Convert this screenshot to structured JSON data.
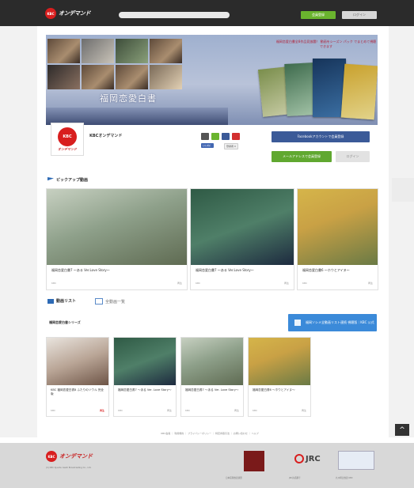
{
  "header": {
    "logo_mark": "KBC",
    "logo_text": "オンデマンド",
    "search_placeholder": "",
    "login_label": "会員登録",
    "signup_label": "ログイン"
  },
  "banner": {
    "title": "福岡恋愛白書",
    "caption": "福岡恋愛白書全8作品見放題！ 動画をシーズン パック でまとめて視聴できます"
  },
  "channel": {
    "name": "KBCオンデマンド",
    "facebook_button": "Facebookアカウントで会員登録",
    "register_button": "メールアドレスで会員登録",
    "guest_button": "ログイン",
    "like_label": "いいね！",
    "subscribe_label": "登録者 0"
  },
  "pickup": {
    "title": "ピックアップ動画",
    "cards": [
      {
        "title": "福岡恋愛白書7 ～ある Ver.Love Story～",
        "meta": "KBC",
        "views": "再生"
      },
      {
        "title": "福岡恋愛白書7 ～ある Ver.Love Story～",
        "meta": "KBC",
        "views": "再生"
      },
      {
        "title": "福岡恋愛白書6 ～ホウとアイヌ～",
        "meta": "KBC",
        "views": "再生"
      }
    ]
  },
  "tabs": {
    "list": "動画リスト",
    "all": "全動画一覧"
  },
  "series": {
    "title": "福岡恋愛白書シリーズ",
    "button": "福岡ソシメ全動画リスト連続 視聴版｜KBC 公式",
    "cards": [
      {
        "title": "KBC 福岡恋愛白書8 ふたりのソウル 完全版",
        "meta": "KBC",
        "views": "再生"
      },
      {
        "title": "福岡恋愛白書7 ～ある Ver. Love Story～",
        "meta": "KBC",
        "views": "再生"
      },
      {
        "title": "福岡恋愛白書7 ～ある Ver. Love Story～",
        "meta": "KBC",
        "views": "再生"
      },
      {
        "title": "福岡恋愛白書6 ～ホウとアイヌ～",
        "meta": "KBC",
        "views": "再生"
      }
    ]
  },
  "footer": {
    "links": "KBC会員 ｜ 利用規約 ｜ プライバシーポリシー ｜ 特定商取引法 ｜ お問い合わせ ｜ ヘルプ",
    "copyright": "(C) KBC Kyushu Asahi Broadcasting Co., Ltd.",
    "logo_text": "オンデマンド",
    "logo_mark": "KBC",
    "jrc_label": "JRC",
    "caption1": "日本民間放送連盟",
    "caption2": "JRC許諾番号",
    "caption3": "九州朝日放送 KBC"
  },
  "to_top": "^"
}
